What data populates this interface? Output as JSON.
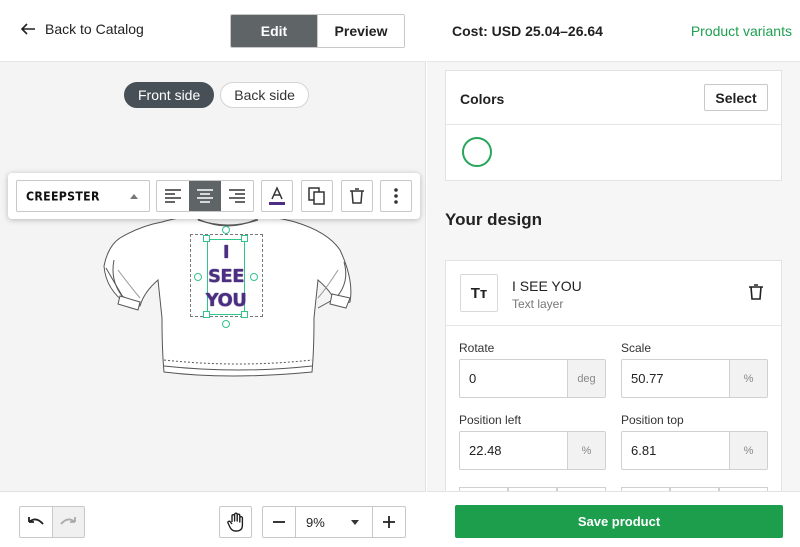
{
  "header": {
    "back_label": "Back to Catalog",
    "edit_label": "Edit",
    "preview_label": "Preview"
  },
  "canvas": {
    "front_label": "Front side",
    "back_label": "Back side",
    "design_text_lines": [
      "I",
      "SEE",
      "YOU"
    ],
    "text_color": "#4b2d84"
  },
  "toolbar": {
    "font_name": "CREEPSTER",
    "active_alignment": "center",
    "icons": [
      "align-left-icon",
      "align-center-icon",
      "align-right-icon",
      "text-color-icon",
      "duplicate-icon",
      "delete-icon",
      "more-icon"
    ]
  },
  "bottom": {
    "zoom_value": "9%"
  },
  "right": {
    "cost_label": "Cost: USD 25.04–26.64",
    "variants_link": "Product variants",
    "colors_label": "Colors",
    "select_label": "Select",
    "your_design_label": "Your design",
    "layer": {
      "icon_text": "Tт",
      "name": "I SEE YOU",
      "type": "Text layer",
      "rotate_label": "Rotate",
      "rotate_value": "0",
      "rotate_unit": "deg",
      "scale_label": "Scale",
      "scale_value": "50.77",
      "scale_unit": "%",
      "pos_left_label": "Position left",
      "pos_left_value": "22.48",
      "pos_left_unit": "%",
      "pos_top_label": "Position top",
      "pos_top_value": "6.81",
      "pos_top_unit": "%"
    },
    "save_label": "Save product",
    "accent_color": "#1c9e4d"
  }
}
